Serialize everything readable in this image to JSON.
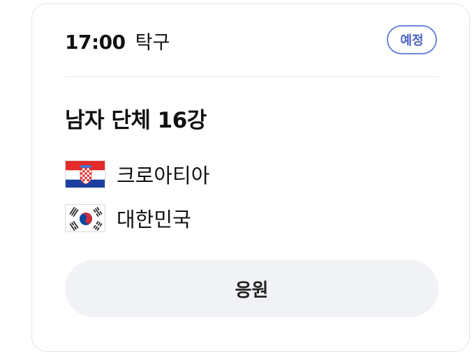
{
  "match": {
    "time": "17:00",
    "sport": "탁구",
    "status": "예정",
    "event_title": "남자 단체 16강"
  },
  "teams": [
    {
      "name": "크로아티아",
      "flag": "croatia-flag-icon"
    },
    {
      "name": "대한민국",
      "flag": "south-korea-flag-icon"
    }
  ],
  "actions": {
    "cheer_label": "응원"
  },
  "colors": {
    "badge_border": "#6f86d6",
    "badge_text": "#4a63c2",
    "button_bg": "#f1f2f5",
    "croatia_red": "#e42a2a",
    "croatia_blue": "#1c3fa0",
    "korea_red": "#cd2e3a",
    "korea_blue": "#0047a0"
  }
}
